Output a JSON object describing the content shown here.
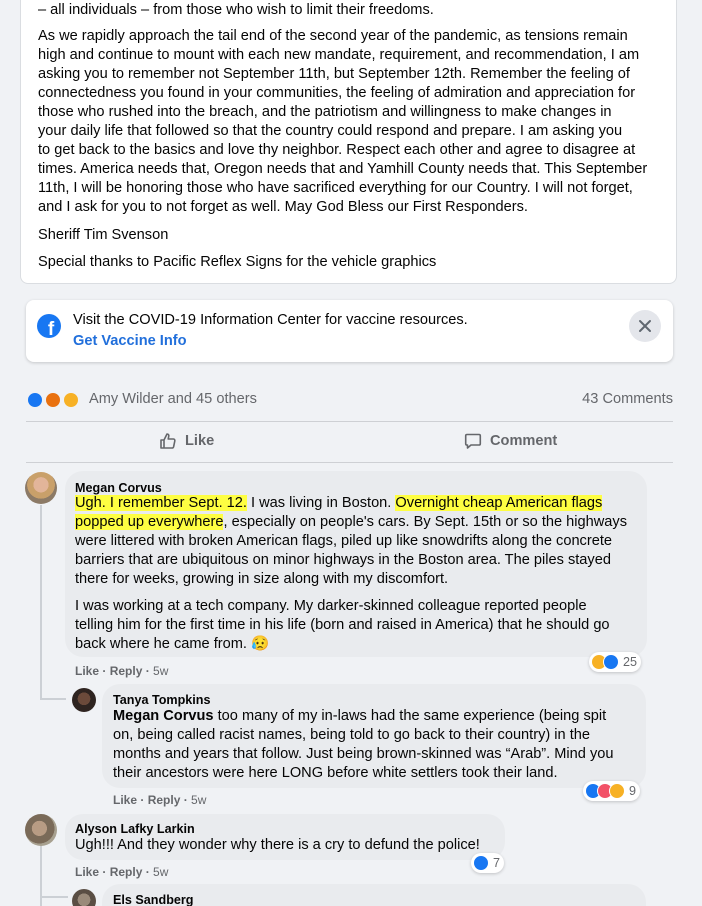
{
  "post": {
    "line0": "– all individuals – from those who wish to limit their freedoms.",
    "p1": [
      "As we rapidly approach the tail end of the second year of the pandemic, as tensions remain",
      "high and continue to mount with each new mandate, requirement, and recommendation, I am",
      "asking you to remember not September 11th, but September 12th. Remember the feeling of",
      "connectedness you found in your communities, the feeling of admiration and appreciation for",
      "those who rushed into the breach, and the patriotism and willingness to make changes in",
      "your daily life that followed so that the country could respond and prepare. I am asking you",
      "to get back to the basics and love thy neighbor. Respect each other and agree to disagree at",
      "times. America needs that, Oregon needs that and Yamhill County needs that. This September",
      "11th, I will be honoring those who have sacrificed everything for our Country. I will not forget,",
      "and I ask for you to not forget as well. May God Bless our First Responders."
    ],
    "signature": "Sheriff Tim Svenson",
    "thanks": "Special thanks to Pacific Reflex Signs for the vehicle graphics"
  },
  "covid": {
    "text": "Visit the COVID-19 Information Center for vaccine resources.",
    "link": "Get Vaccine Info",
    "logo_icon": "facebook-logo-icon",
    "close_icon": "close-icon"
  },
  "reactions": {
    "names": "Amy Wilder and 45 others",
    "comments": "43 Comments"
  },
  "actions": {
    "like": "Like",
    "comment": "Comment"
  },
  "comments": [
    {
      "name": "Megan Corvus",
      "p1_lines": [
        {
          "hl1": "Ugh. I remember Sept. 12.",
          "rest1": " I was living in Boston. ",
          "hl2": "Overnight cheap American flags"
        },
        {
          "hl": "popped up everywhere",
          "rest": ", especially on people's cars. By Sept. 15th or so the highways"
        },
        "were littered with broken American flags, piled up like snowdrifts along the concrete",
        "barriers that are ubiquitous on minor highways in the Boston area. The piles stayed",
        "there for weeks, growing in size along with my discomfort."
      ],
      "p2_lines": [
        "I was working at a tech company. My darker-skinned colleague reported people",
        "telling him for the first time in his life (born and raised in America) that he should go",
        "back where he came from. 😥"
      ],
      "like": "Like",
      "reply": "Reply",
      "time": "5w",
      "reaction_count": "25"
    },
    {
      "name": "Tanya Tompkins",
      "mention": "Megan Corvus",
      "lines": [
        " too many of my in-laws had the same experience (being spit",
        "on, being called racist names, being told to go back to their country) in the",
        "months and years that follow. Just being brown-skinned was “Arab”. Mind you",
        "their ancestors were here LONG before white settlers took their land."
      ],
      "like": "Like",
      "reply": "Reply",
      "time": "5w",
      "reaction_count": "9"
    },
    {
      "name": "Alyson Lafky Larkin",
      "text": "Ugh!!! And they wonder why there is a cry to defund the police!",
      "like": "Like",
      "reply": "Reply",
      "time": "5w",
      "reaction_count": "7"
    },
    {
      "name": "Els Sandberg"
    }
  ],
  "colors": {
    "like_blue": "#1877f2",
    "link_blue": "#216fdb",
    "highlight": "#fefe42",
    "bubble": "#e9ebee"
  }
}
